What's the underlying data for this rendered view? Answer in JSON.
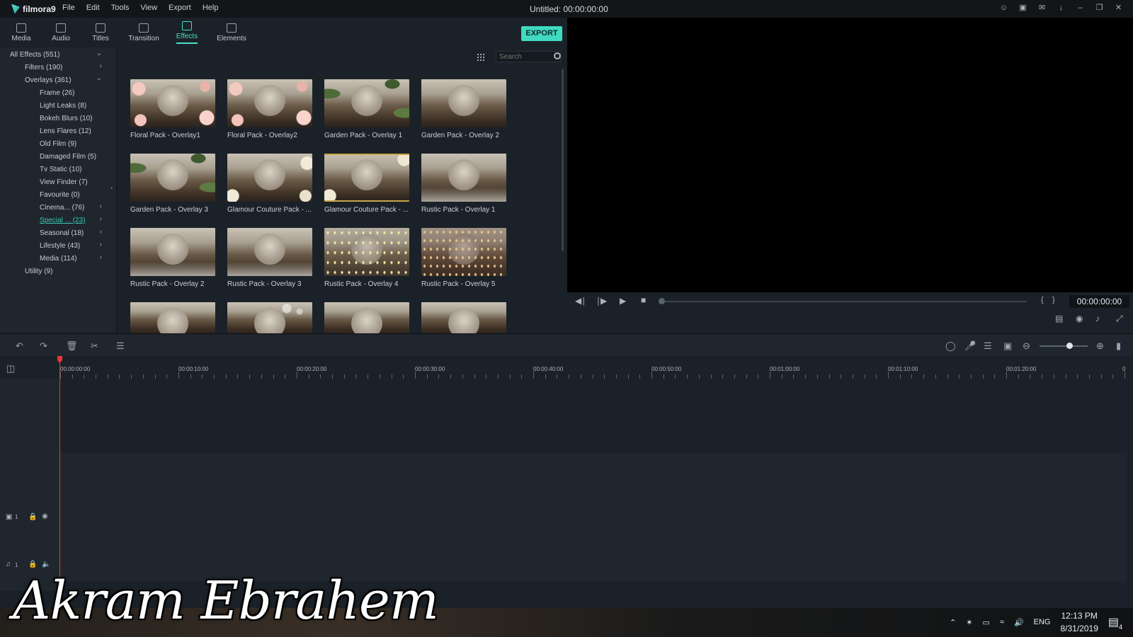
{
  "app": {
    "logo_text": "filmora9",
    "title": "Untitled:  00:00:00:00",
    "menu": [
      "File",
      "Edit",
      "Tools",
      "View",
      "Export",
      "Help"
    ]
  },
  "tabs": [
    {
      "label": "Media",
      "icon": "folder-icon"
    },
    {
      "label": "Audio",
      "icon": "music-note-icon"
    },
    {
      "label": "Titles",
      "icon": "text-icon"
    },
    {
      "label": "Transition",
      "icon": "transition-icon"
    },
    {
      "label": "Effects",
      "icon": "effects-icon",
      "active": true
    },
    {
      "label": "Elements",
      "icon": "image-icon"
    }
  ],
  "export_label": "EXPORT",
  "accent_color": "#40d9c2",
  "tree": {
    "items": [
      {
        "label": "All Effects (551)",
        "expanded": true
      },
      {
        "label": "Filters (190)"
      },
      {
        "label": "Overlays (361)",
        "expanded": true
      },
      {
        "label": "Frame (26)"
      },
      {
        "label": "Light Leaks (8)"
      },
      {
        "label": "Bokeh Blurs (10)"
      },
      {
        "label": "Lens Flares (12)"
      },
      {
        "label": "Old Film (9)"
      },
      {
        "label": "Damaged Film (5)"
      },
      {
        "label": "Tv Static (10)"
      },
      {
        "label": "View Finder (7)"
      },
      {
        "label": "Favourite (0)"
      },
      {
        "label": "Cinema... (76)"
      },
      {
        "label": "Special ... (23)",
        "selected": true
      },
      {
        "label": "Seasonal (18)"
      },
      {
        "label": "Lifestyle (43)"
      },
      {
        "label": "Media (114)"
      },
      {
        "label": "Utility (9)"
      }
    ]
  },
  "search": {
    "placeholder": "Search",
    "value": ""
  },
  "effects": [
    {
      "label": "Floral Pack - Overlay1",
      "overlay": "floral"
    },
    {
      "label": "Floral Pack - Overlay2",
      "overlay": "floral"
    },
    {
      "label": "Garden Pack - Overlay 1",
      "overlay": "garden"
    },
    {
      "label": "Garden Pack - Overlay 2",
      "overlay": "none"
    },
    {
      "label": "Garden Pack - Overlay 3",
      "overlay": "garden"
    },
    {
      "label": "Glamour Couture Pack - ...",
      "overlay": "glamour"
    },
    {
      "label": "Glamour Couture Pack - ...",
      "overlay": "glamour-gold"
    },
    {
      "label": "Rustic Pack - Overlay 1",
      "overlay": "rustic"
    },
    {
      "label": "Rustic Pack - Overlay 2",
      "overlay": "rustic"
    },
    {
      "label": "Rustic Pack - Overlay 3",
      "overlay": "rustic"
    },
    {
      "label": "Rustic Pack - Overlay 4",
      "overlay": "lights"
    },
    {
      "label": "Rustic Pack - Overlay 5",
      "overlay": "lights-dark"
    },
    {
      "label": "",
      "overlay": "none"
    },
    {
      "label": "",
      "overlay": "bokeh"
    },
    {
      "label": "",
      "overlay": "none"
    },
    {
      "label": "",
      "overlay": "none"
    }
  ],
  "preview": {
    "timecode": "00:00:00:00",
    "playback_progress": 0
  },
  "timeline": {
    "ruler": [
      "00:00:00:00",
      "00:00:10:00",
      "00:00:20:00",
      "00:00:30:00",
      "00:00:40:00",
      "00:00:50:00",
      "00:01:00:00",
      "00:01:10:00",
      "00:01:20:00",
      "0"
    ],
    "video_track_label": "1",
    "audio_track_label": "1",
    "zoom_level": 0.62
  },
  "watermark": "Akram Ebrahem",
  "taskbar": {
    "language": "ENG",
    "time": "12:13 PM",
    "date": "8/31/2019",
    "notifications": "4"
  }
}
